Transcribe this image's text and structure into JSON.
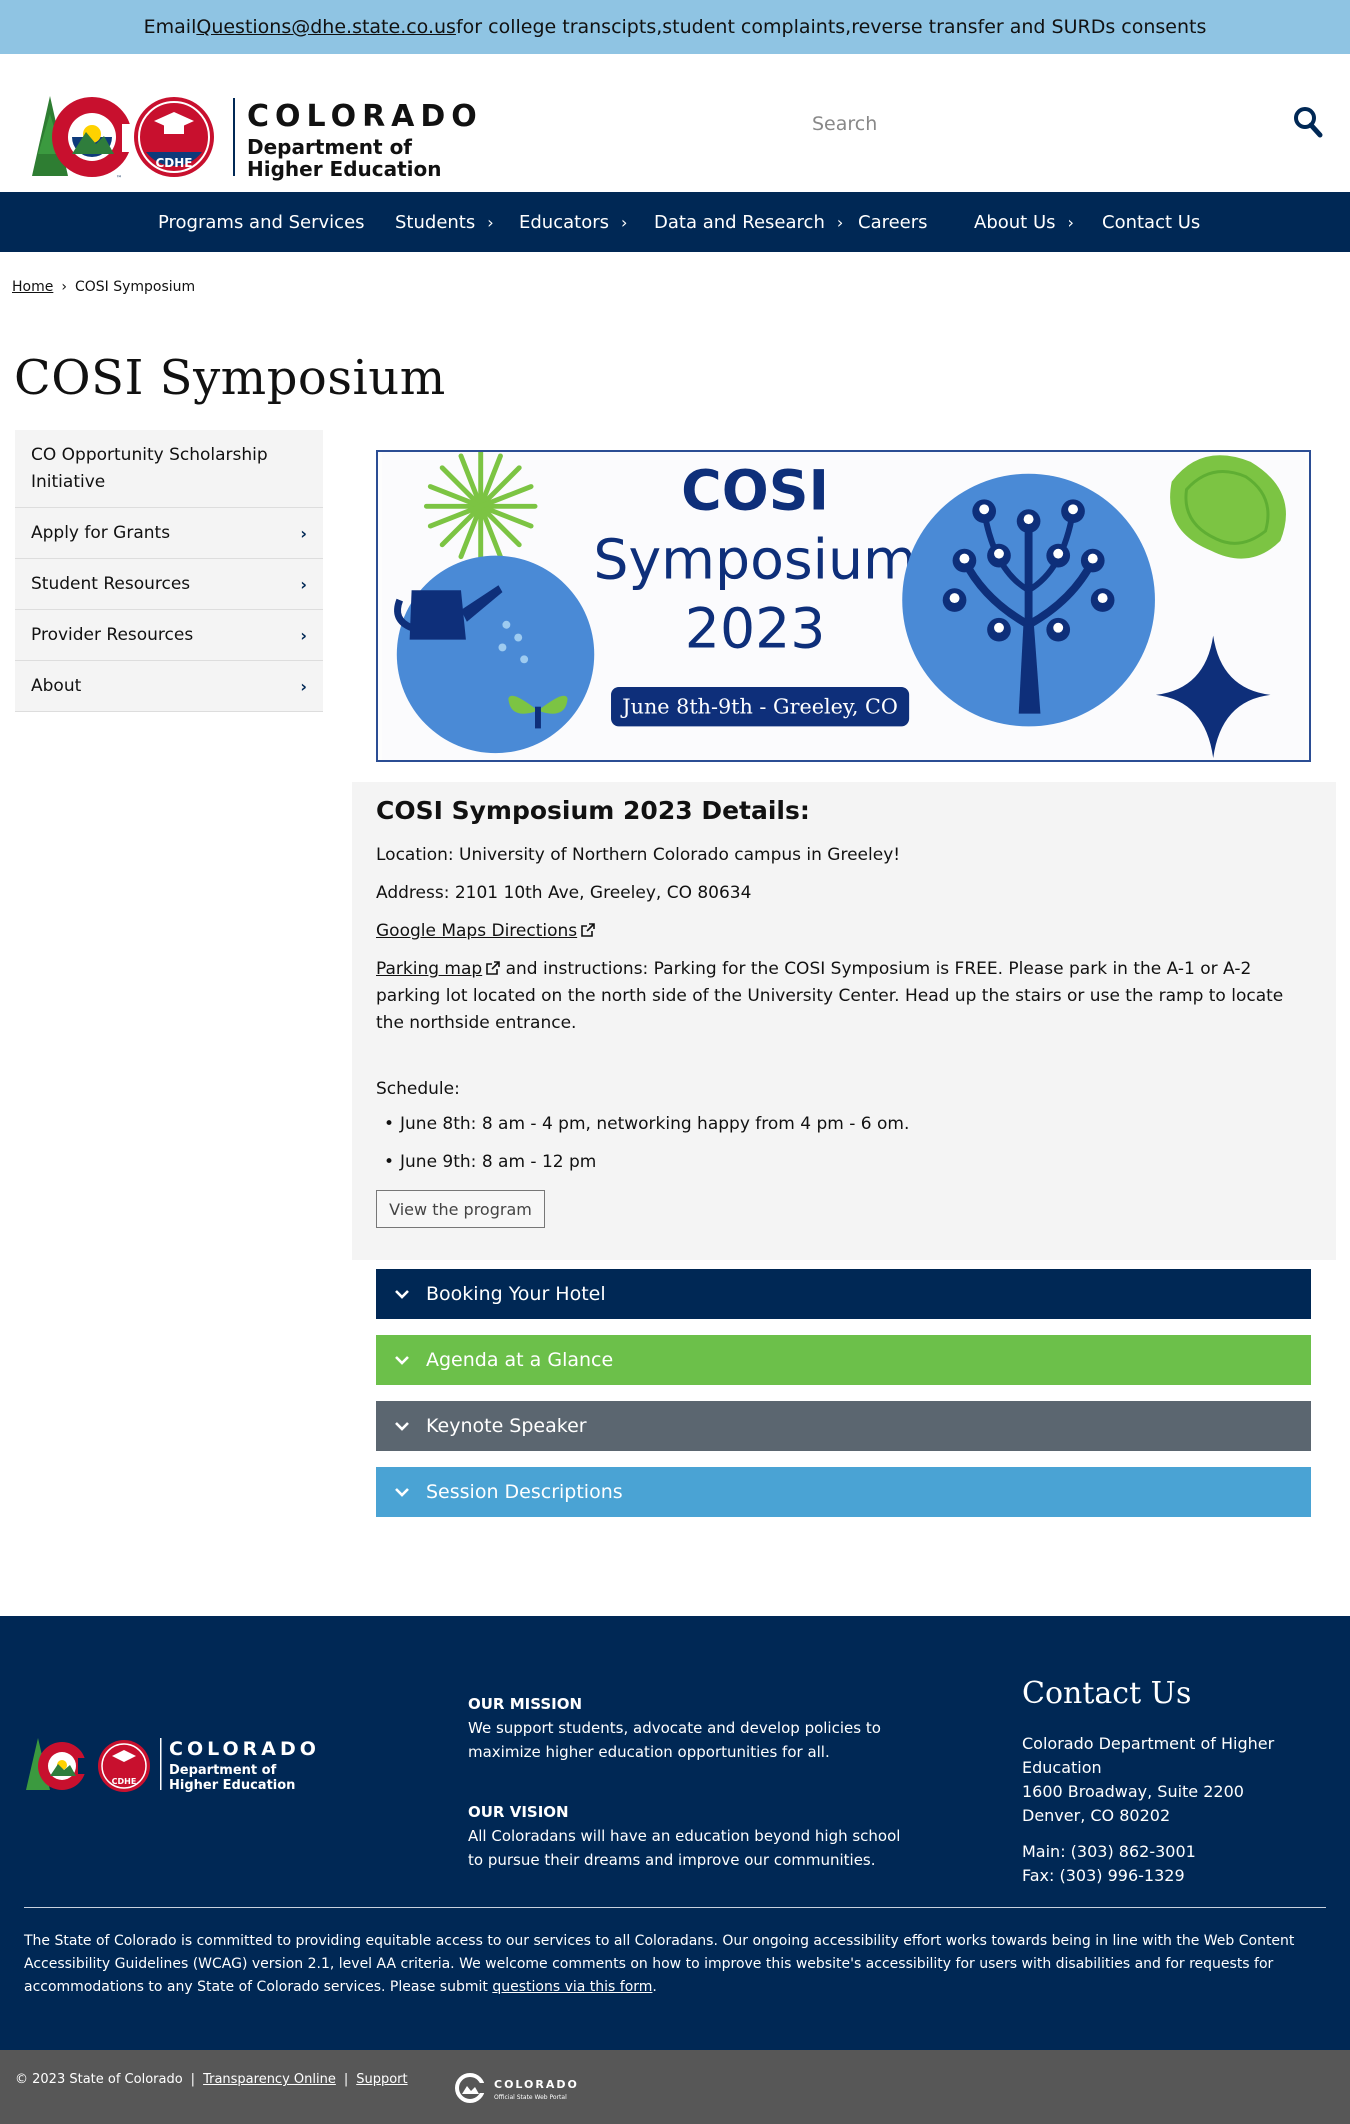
{
  "alert": {
    "prefix": "Email ",
    "email": "Questions@dhe.state.co.us",
    "suffix": " for college transcipts,student complaints,reverse transfer and SURDs consents"
  },
  "header": {
    "logo": {
      "state": "COLORADO",
      "badge": "CDHE",
      "dept_line1": "Department of",
      "dept_line2": "Higher Education"
    },
    "search_placeholder": "Search",
    "search_icon": "search-icon"
  },
  "nav": {
    "items": [
      {
        "label": "Programs and Services",
        "has_sub": false
      },
      {
        "label": "Students",
        "has_sub": true
      },
      {
        "label": "Educators",
        "has_sub": true
      },
      {
        "label": "Data and Research",
        "has_sub": true
      },
      {
        "label": "Careers",
        "has_sub": false
      },
      {
        "label": "About Us",
        "has_sub": true
      },
      {
        "label": "Contact Us",
        "has_sub": false
      }
    ]
  },
  "breadcrumb": {
    "home": "Home",
    "sep": "›",
    "current": "COSI Symposium"
  },
  "page_title": "COSI Symposium",
  "sidebar": {
    "items": [
      {
        "label": "CO Opportunity Scholarship Initiative",
        "chevron": false
      },
      {
        "label": "Apply for Grants",
        "chevron": true
      },
      {
        "label": "Student Resources",
        "chevron": true
      },
      {
        "label": "Provider Resources",
        "chevron": true
      },
      {
        "label": "About",
        "chevron": true
      }
    ]
  },
  "banner": {
    "line1": "COSI",
    "line2": "Symposium",
    "line3": "2023",
    "dates": "June 8th-9th - Greeley, CO"
  },
  "details": {
    "heading": "COSI Symposium 2023 Details:",
    "location": "Location: University of Northern Colorado campus in Greeley!",
    "address": "Address: 2101 10th Ave, Greeley, CO 80634",
    "maps_link": "Google Maps Directions",
    "parking_link": "Parking map",
    "parking_text": " and instructions: Parking for the COSI Symposium is FREE. Please park in the A-1 or A-2 parking lot located on the north side of the University Center. Head up the stairs or use the ramp to locate the northside entrance.",
    "schedule_label": "Schedule:",
    "schedule": [
      "June 8th: 8 am - 4 pm, networking happy from 4 pm - 6 om.",
      "June 9th: 8 am - 12 pm"
    ],
    "program_button": "View the program"
  },
  "accordions": [
    {
      "label": "Booking Your Hotel",
      "color": "#002855"
    },
    {
      "label": "Agenda at a Glance",
      "color": "#6cc04a"
    },
    {
      "label": "Keynote Speaker",
      "color": "#5b6670"
    },
    {
      "label": "Session Descriptions",
      "color": "#4aa3d4"
    }
  ],
  "footer": {
    "logo": {
      "state": "COLORADO",
      "badge": "CDHE",
      "dept_line1": "Department of",
      "dept_line2": "Higher Education"
    },
    "mission_heading": "OUR MISSION",
    "mission_line1": "We support students, advocate and develop policies to",
    "mission_line2": "maximize higher education opportunities for all.",
    "vision_heading": "OUR VISION",
    "vision_line1": "All Coloradans will have an education beyond high school",
    "vision_line2": "to pursue their dreams and improve our communities.",
    "contact_heading": "Contact Us",
    "contact_org": "Colorado Department of Higher Education",
    "contact_addr1": "1600 Broadway, Suite 2200",
    "contact_addr2": "Denver, CO 80202",
    "contact_main": "Main: (303) 862-3001",
    "contact_fax": "Fax: (303) 996-1329",
    "accessibility_text": "The State of Colorado is committed to providing equitable access to our services to all Coloradans. Our ongoing accessibility effort works towards being in line with the Web Content Accessibility Guidelines (WCAG) version 2.1, level AA criteria. We welcome comments on how to improve this website's accessibility for users with disabilities and for requests for accommodations to any State of Colorado services. Please submit ",
    "accessibility_link": "questions via this form",
    "accessibility_end": "."
  },
  "bottom": {
    "copyright": "© 2023 State of Colorado",
    "sep": "|",
    "transparency": "Transparency Online",
    "support": "Support",
    "portal_title": "COLORADO",
    "portal_sub": "Official State Web Portal"
  },
  "colors": {
    "navy": "#002855",
    "alert_blue": "#8fc4e3",
    "green": "#6cc04a",
    "gray": "#5b6670",
    "light_blue": "#4aa3d4",
    "bottom_gray": "#575757"
  }
}
